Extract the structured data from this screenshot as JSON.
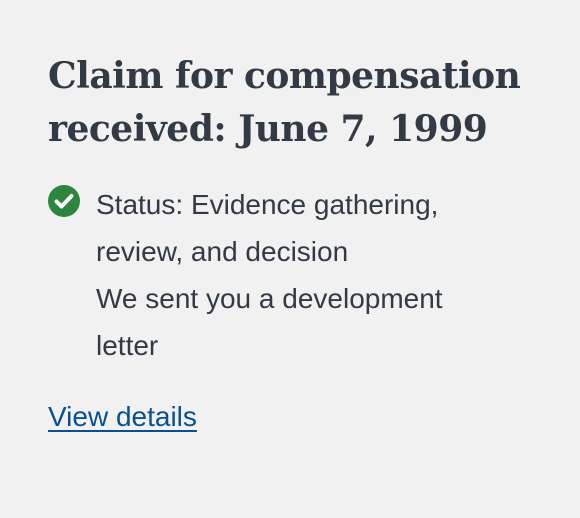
{
  "claim": {
    "title": "Claim for compensation received: June 7, 1999",
    "status_label": "Status: Evidence gathering, review, and decision",
    "message": "We sent you a development letter",
    "link_label": "View details",
    "status_icon": "check-circle-icon",
    "colors": {
      "background": "#f1f1f1",
      "text": "#323a45",
      "success": "#2e8540",
      "link": "#0b4f8f"
    }
  }
}
